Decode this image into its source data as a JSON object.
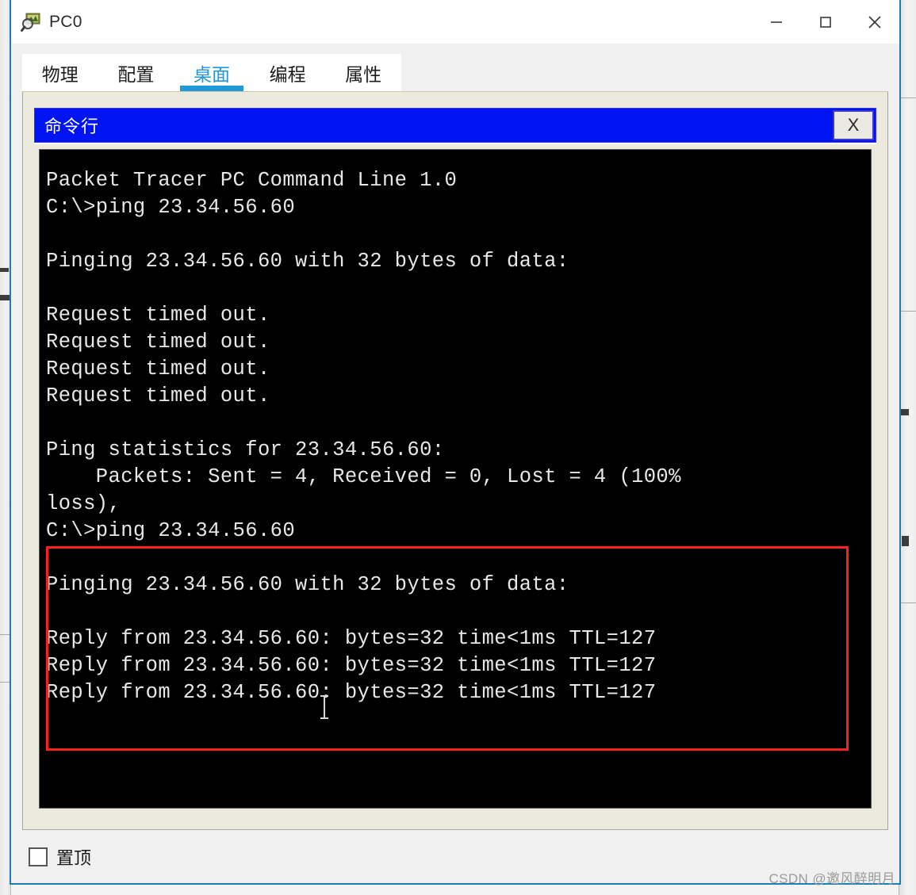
{
  "window": {
    "title": "PC0",
    "icon": "packet-tracer-pc-icon",
    "controls": {
      "minimize": "–",
      "maximize": "□",
      "close": "✕"
    }
  },
  "tabs": [
    {
      "label": "物理",
      "active": false
    },
    {
      "label": "配置",
      "active": false
    },
    {
      "label": "桌面",
      "active": true
    },
    {
      "label": "编程",
      "active": false
    },
    {
      "label": "属性",
      "active": false
    }
  ],
  "cmd_window": {
    "title": "命令行",
    "close_label": "X"
  },
  "terminal": {
    "lines": [
      "Packet Tracer PC Command Line 1.0",
      "C:\\>ping 23.34.56.60",
      "",
      "Pinging 23.34.56.60 with 32 bytes of data:",
      "",
      "Request timed out.",
      "Request timed out.",
      "Request timed out.",
      "Request timed out.",
      "",
      "Ping statistics for 23.34.56.60:",
      "    Packets: Sent = 4, Received = 0, Lost = 4 (100%",
      "loss),",
      "C:\\>ping 23.34.56.60",
      "",
      "Pinging 23.34.56.60 with 32 bytes of data:",
      "",
      "Reply from 23.34.56.60: bytes=32 time<1ms TTL=127",
      "Reply from 23.34.56.60: bytes=32 time<1ms TTL=127",
      "Reply from 23.34.56.60: bytes=32 time<1ms TTL=127"
    ]
  },
  "footer": {
    "always_on_top_label": "置顶",
    "always_on_top_checked": false
  },
  "watermark": "CSDN @邀风醉明月",
  "colors": {
    "window_accent": "#1a7fb5",
    "tab_active": "#1f9ad6",
    "cmd_titlebar": "#0013f2",
    "desktop_pane": "#ece9dd",
    "terminal_bg": "#000000",
    "terminal_fg": "#e8e8e8",
    "highlight_box": "#fd2020"
  }
}
